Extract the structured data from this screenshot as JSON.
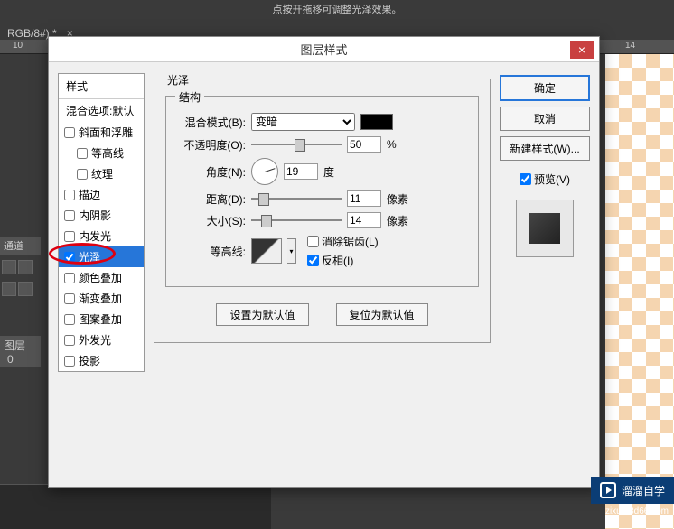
{
  "top_hint": "点按开拖移可调整光泽效果。",
  "tab": {
    "name": "RGB/8#) *",
    "close": "×"
  },
  "ruler_marks": {
    "r10": "10",
    "r14": "14"
  },
  "left_panel": {
    "channels": "通道",
    "layers": "图层",
    "layer_num": "0"
  },
  "dialog": {
    "title": "图层样式",
    "close": "×",
    "styles_header": "样式",
    "blend_options": "混合选项:默认",
    "style_items": [
      {
        "label": "斜面和浮雕",
        "checked": false,
        "indent": false
      },
      {
        "label": "等高线",
        "checked": false,
        "indent": true
      },
      {
        "label": "纹理",
        "checked": false,
        "indent": true
      },
      {
        "label": "描边",
        "checked": false,
        "indent": false
      },
      {
        "label": "内阴影",
        "checked": false,
        "indent": false
      },
      {
        "label": "内发光",
        "checked": false,
        "indent": false
      },
      {
        "label": "光泽",
        "checked": true,
        "indent": false,
        "selected": true
      },
      {
        "label": "颜色叠加",
        "checked": false,
        "indent": false
      },
      {
        "label": "渐变叠加",
        "checked": false,
        "indent": false
      },
      {
        "label": "图案叠加",
        "checked": false,
        "indent": false
      },
      {
        "label": "外发光",
        "checked": false,
        "indent": false
      },
      {
        "label": "投影",
        "checked": false,
        "indent": false
      }
    ],
    "effect_title": "光泽",
    "structure_title": "结构",
    "blend_mode_label": "混合模式(B):",
    "blend_mode_value": "变暗",
    "opacity_label": "不透明度(O):",
    "opacity_value": "50",
    "opacity_unit": "%",
    "angle_label": "角度(N):",
    "angle_value": "19",
    "angle_unit": "度",
    "distance_label": "距离(D):",
    "distance_value": "11",
    "distance_unit": "像素",
    "size_label": "大小(S):",
    "size_value": "14",
    "size_unit": "像素",
    "contour_label": "等高线:",
    "antialias_label": "消除锯齿(L)",
    "antialias_checked": false,
    "invert_label": "反相(I)",
    "invert_checked": true,
    "make_default": "设置为默认值",
    "reset_default": "复位为默认值",
    "ok": "确定",
    "cancel": "取消",
    "new_style": "新建样式(W)...",
    "preview_label": "预览(V)",
    "preview_checked": true
  },
  "watermark": {
    "text": "溜溜自学",
    "url": "zixue.3d66.com"
  }
}
